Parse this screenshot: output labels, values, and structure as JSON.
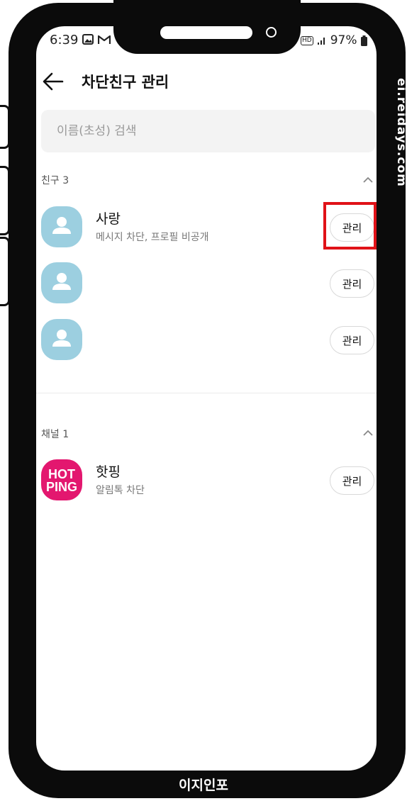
{
  "status_bar": {
    "time": "6:39",
    "battery": "97%",
    "hd": "HD"
  },
  "header": {
    "title": "차단친구 관리"
  },
  "search": {
    "placeholder": "이름(초성) 검색"
  },
  "friends_section": {
    "label": "친구 3",
    "items": [
      {
        "name": "사랑",
        "description": "메시지 차단, 프로필 비공개",
        "button": "관리"
      },
      {
        "name": "",
        "description": "",
        "button": "관리"
      },
      {
        "name": "",
        "description": "",
        "button": "관리"
      }
    ]
  },
  "channels_section": {
    "label": "채널 1",
    "items": [
      {
        "name": "핫핑",
        "description": "알림톡 차단",
        "button": "관리",
        "logo_line1": "HOT",
        "logo_line2": "PING"
      }
    ]
  },
  "watermarks": {
    "side": "ei.reidays.com",
    "bottom": "이지인포"
  },
  "colors": {
    "avatar": "#9ccfe0",
    "hotping": "#e3176f",
    "highlight": "#e01218"
  },
  "icons": [
    "back-arrow-icon",
    "chevron-up-icon",
    "default-profile-icon",
    "gallery-icon",
    "gmail-icon",
    "signal-icon",
    "battery-icon"
  ]
}
